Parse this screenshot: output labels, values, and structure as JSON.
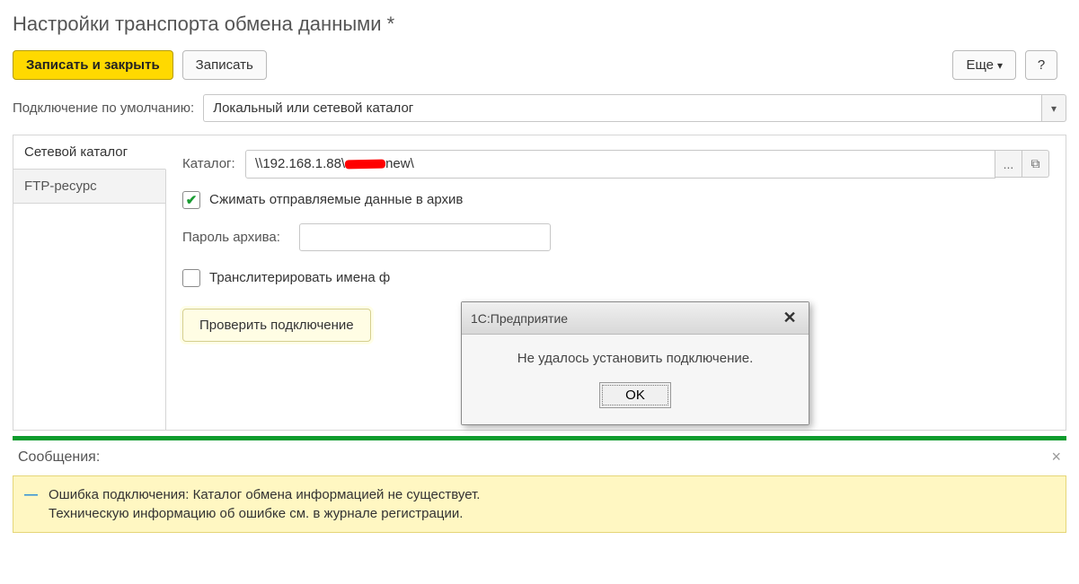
{
  "page_title": "Настройки транспорта обмена данными *",
  "toolbar": {
    "save_close_label": "Записать и закрыть",
    "save_label": "Записать",
    "more_label": "Еще",
    "help_label": "?"
  },
  "default_conn": {
    "label": "Подключение по умолчанию:",
    "value": "Локальный или сетевой каталог"
  },
  "tabs": {
    "network": "Сетевой каталог",
    "ftp": "FTP-ресурс"
  },
  "catalog": {
    "label": "Каталог:",
    "value_prefix": "\\\\192.168.1.88\\",
    "value_suffix": "new\\",
    "browse": "...",
    "copy_icon": "⧉"
  },
  "compress": {
    "checked": true,
    "label": "Сжимать отправляемые данные в архив"
  },
  "archive_password": {
    "label": "Пароль архива:",
    "value": ""
  },
  "transliterate": {
    "checked": false,
    "label": "Транслитерировать имена ф"
  },
  "check_btn": "Проверить подключение",
  "modal": {
    "title": "1С:Предприятие",
    "message": "Не удалось установить подключение.",
    "ok": "OK"
  },
  "messages": {
    "title": "Сообщения:",
    "error_line1": "Ошибка подключения: Каталог обмена информацией не существует.",
    "error_line2": "Техническую информацию об ошибке см. в журнале регистрации."
  }
}
